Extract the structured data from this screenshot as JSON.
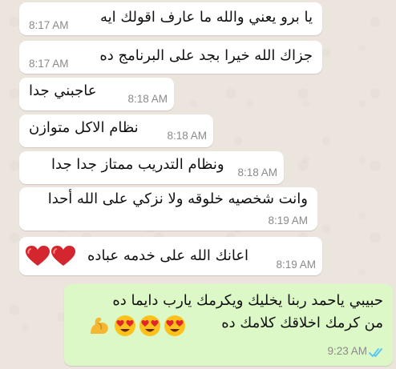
{
  "colors": {
    "chat_background": "#ece5dd",
    "incoming_bubble": "#ffffff",
    "outgoing_bubble": "#dcf8c6",
    "timestamp": "#8a8a8a",
    "read_ticks": "#4fc3f7",
    "heart": "#d3262f"
  },
  "messages": [
    {
      "direction": "incoming",
      "text": "يا برو يعني والله ما عارف اقولك ايه",
      "time": "8:17 AM"
    },
    {
      "direction": "incoming",
      "text": "جزاك الله خيرا بجد على البرنامج ده",
      "time": "8:17 AM"
    },
    {
      "direction": "incoming",
      "text": "عاجبني جدا",
      "time": "8:18 AM"
    },
    {
      "direction": "incoming",
      "text": "نظام الاكل متوازن",
      "time": "8:18 AM"
    },
    {
      "direction": "incoming",
      "text": "ونظام التدريب ممتاز جدا جدا",
      "time": "8:18 AM"
    },
    {
      "direction": "incoming",
      "text": "وانت شخصيه خلوقه ولا نزكي على الله أحدا",
      "time": "8:19 AM"
    },
    {
      "direction": "incoming",
      "text": "اعانك الله على خدمه عباده",
      "emoji": [
        "red-heart",
        "red-heart"
      ],
      "time": "8:19 AM"
    },
    {
      "direction": "outgoing",
      "lines": [
        "حبيبي ياحمد ربنا يخليك ويكرمك يارب دايما ده",
        "من كرمك اخلاقك كلامك ده"
      ],
      "emoji": [
        "heart-eyes-face",
        "heart-eyes-face",
        "heart-eyes-face",
        "flexed-biceps"
      ],
      "time": "9:23 AM",
      "status": "read"
    }
  ]
}
